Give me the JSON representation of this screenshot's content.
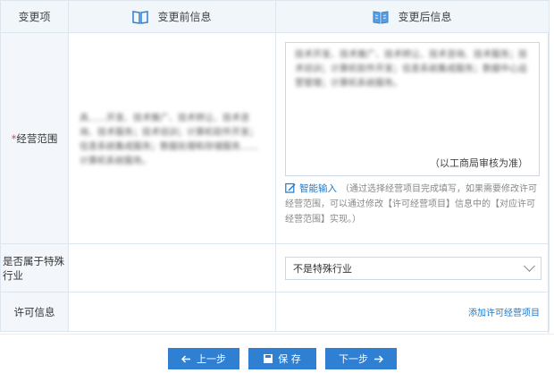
{
  "table": {
    "headers": {
      "item": "变更项",
      "before": "变更前信息",
      "after": "变更后信息"
    },
    "scope": {
      "required_mark": "*",
      "label": "经营范围",
      "before_text": "具……开发、技术推广、技术转让、技术咨询、技术服务；技术培训；计算机软件开发；信息系统集成服务；数据处理和存储服务……计算机系统服务。",
      "after_text": "技术开发、技术推广、技术转让、技术咨询、技术服务；技术培训；计算机软件开发；信息系统集成服务；数据中心运营管理；计算机系统服务。",
      "review_note": "（以工商局审核为准）",
      "smart_input_label": "智能输入",
      "smart_input_hint": "（通过选择经营项目完成填写，如果需要修改许可经营范围，可以通过修改【许可经营项目】信息中的【对应许可经营范围】实现。）"
    },
    "special": {
      "label": "是否属于特殊行业",
      "selected": "不是特殊行业"
    },
    "license": {
      "label": "许可信息",
      "add_link": "添加许可经营项目"
    }
  },
  "buttons": {
    "prev": "上一步",
    "save": "保 存",
    "next": "下一步"
  },
  "colors": {
    "accent": "#2f7fd3",
    "link": "#1f78c8",
    "required": "#e0463c",
    "header_bg": "#f1f6fb"
  }
}
